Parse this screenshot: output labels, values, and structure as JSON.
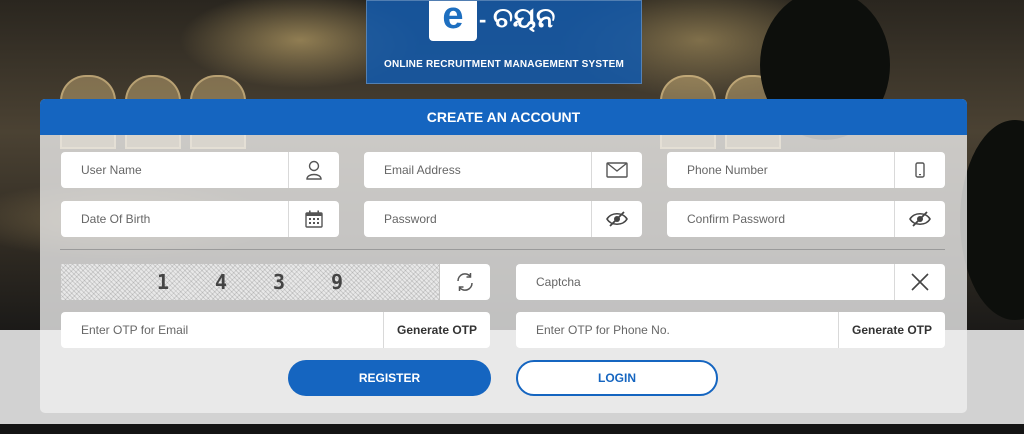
{
  "logo": {
    "mark": "e",
    "dash": "-",
    "brand_script": "ଚୟନ",
    "tagline": "ONLINE RECRUITMENT MANAGEMENT SYSTEM"
  },
  "form": {
    "title": "CREATE AN ACCOUNT",
    "user_name": {
      "placeholder": "User Name",
      "icon": "user-icon"
    },
    "email": {
      "placeholder": "Email Address",
      "icon": "envelope-icon"
    },
    "phone": {
      "placeholder": "Phone Number",
      "icon": "mobile-icon"
    },
    "dob": {
      "placeholder": "Date Of Birth",
      "icon": "calendar-icon"
    },
    "password": {
      "placeholder": "Password",
      "icon": "eye-slash-icon"
    },
    "confirm_password": {
      "placeholder": "Confirm Password",
      "icon": "eye-slash-icon"
    },
    "captcha": {
      "digits": [
        "1",
        "4",
        "3",
        "9"
      ],
      "refresh_icon": "refresh-icon"
    },
    "captcha_input": {
      "placeholder": "Captcha",
      "icon": "close-icon"
    },
    "email_otp": {
      "placeholder": "Enter OTP for Email",
      "button": "Generate OTP"
    },
    "phone_otp": {
      "placeholder": "Enter OTP for Phone No.",
      "button": "Generate OTP"
    },
    "register_label": "REGISTER",
    "login_label": "LOGIN"
  },
  "colors": {
    "primary": "#1565c0",
    "card_bg": "#f0f0f0"
  }
}
